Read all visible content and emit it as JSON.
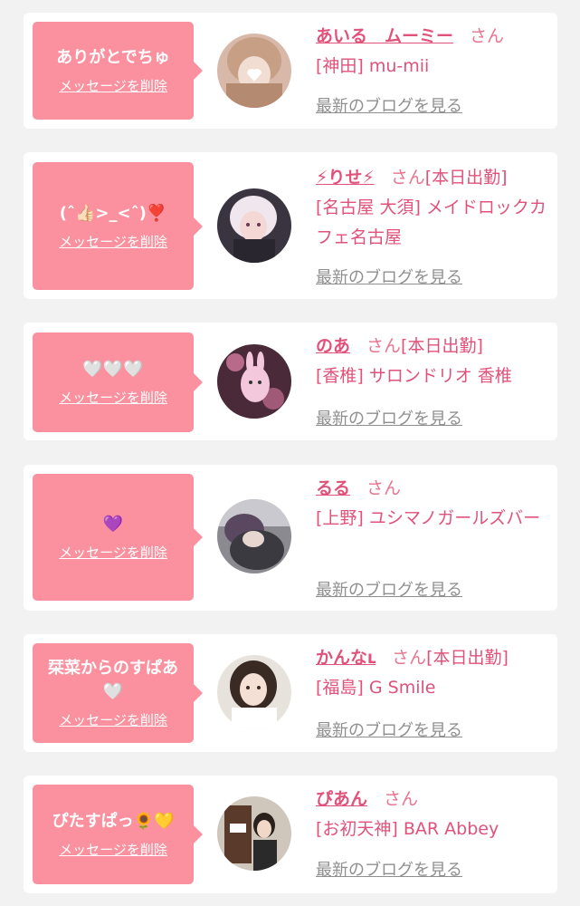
{
  "cards": [
    {
      "message": "ありがとでちゅ",
      "delete_label": "メッセージを削除",
      "name": "あいる　ムーミー",
      "honorific": "さん",
      "status": "",
      "shop": "[神田] mu-mii",
      "blog_label": "最新のブログを見る",
      "avatar": "avatar-photo"
    },
    {
      "message": "(ˆ👍🏻>_<ˆ)❣️",
      "delete_label": "メッセージを削除",
      "name": "⚡りせ⚡",
      "honorific": "さん",
      "status": "[本日出勤]",
      "shop": "[名古屋 大須] メイドロックカフェ名古屋",
      "blog_label": "最新のブログを見る",
      "avatar": "avatar-photo"
    },
    {
      "message": "🤍🤍🤍",
      "delete_label": "メッセージを削除",
      "name": "のあ",
      "honorific": "さん",
      "status": "[本日出勤]",
      "shop": "[香椎] サロンドリオ 香椎",
      "blog_label": "最新のブログを見る",
      "avatar": "avatar-photo"
    },
    {
      "message": "💜",
      "delete_label": "メッセージを削除",
      "name": "るる",
      "honorific": "さん",
      "status": "",
      "shop": "[上野] ユシマノガールズバー",
      "blog_label": "最新のブログを見る",
      "avatar": "avatar-photo"
    },
    {
      "message": "栞菜からのすぱあ🤍",
      "delete_label": "メッセージを削除",
      "name": "かんなւ",
      "honorific": "さん",
      "status": "[本日出勤]",
      "shop": "[福島] G Smile",
      "blog_label": "最新のブログを見る",
      "avatar": "avatar-photo"
    },
    {
      "message": "ぴたすぱっ🌻💛",
      "delete_label": "メッセージを削除",
      "name": "ぴあん",
      "honorific": "さん",
      "status": "",
      "shop": "[お初天神] BAR Abbey",
      "blog_label": "最新のブログを見る",
      "avatar": "avatar-photo"
    }
  ],
  "colors": {
    "bubble": "#fb919f",
    "name": "#e0527a",
    "link_gray": "#8f8f8f",
    "background": "#f2f2f2"
  }
}
